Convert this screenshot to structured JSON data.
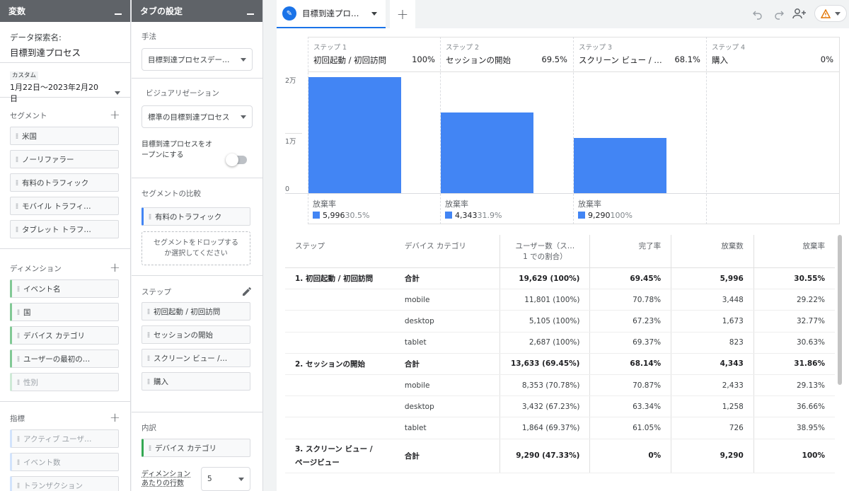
{
  "variables": {
    "header": "変数",
    "exploration_name_label": "データ探索名:",
    "exploration_name": "目標到達プロセス",
    "date_badge": "カスタム",
    "date_range": "1月22日～2023年2月20日",
    "segments_title": "セグメント",
    "segments": [
      "米国",
      "ノーリファラー",
      "有料のトラフィック",
      "モバイル トラフィ…",
      "タブレット トラフ…"
    ],
    "dimensions_title": "ディメンション",
    "dimensions": [
      "イベント名",
      "国",
      "デバイス カテゴリ",
      "ユーザーの最初の…",
      "性別"
    ],
    "metrics_title": "指標",
    "metrics": [
      "アクティブ ユーザ…",
      "イベント数",
      "トランザクション"
    ]
  },
  "tab_settings": {
    "header": "タブの設定",
    "technique_label": "手法",
    "technique_value": "目標到達プロセスデー…",
    "viz_label": "ビジュアリゼーション",
    "viz_value": "標準の目標到達プロセス",
    "open_funnel_label_1": "目標到達プロセスをオ",
    "open_funnel_label_2": "ープンにする",
    "segment_compare_title": "セグメントの比較",
    "segment_compare_chip": "有料のトラフィック",
    "drop_hint_1": "セグメントをドロップする",
    "drop_hint_2": "か選択してください",
    "steps_title": "ステップ",
    "steps": [
      "初回起動 / 初回訪問",
      "セッションの開始",
      "スクリーン ビュー /…",
      "購入"
    ],
    "breakdown_title": "内訳",
    "breakdown_chip": "デバイス カテゴリ",
    "rows_label_1": "ディメンション",
    "rows_label_2": "あたりの行数",
    "rows_value": "5"
  },
  "tabs": {
    "active_label": "目標到達プロ…",
    "add_label": "+"
  },
  "chart_data": {
    "type": "bar",
    "categories": [
      "初回起動 / 初回訪問",
      "セッションの開始",
      "スクリーン ビュー / …",
      "購入"
    ],
    "values": [
      19629,
      13633,
      9290,
      0
    ],
    "ylim": [
      0,
      20000
    ],
    "ytick_labels": [
      "2万",
      "1万",
      "0"
    ],
    "steps": [
      {
        "num": "ステップ 1",
        "name": "初回起動 / 初回訪問",
        "pct": "100%",
        "abandon_label": "放棄率",
        "abandon_value": "5,996",
        "abandon_pct": "30.5%"
      },
      {
        "num": "ステップ 2",
        "name": "セッションの開始",
        "pct": "69.5%",
        "abandon_label": "放棄率",
        "abandon_value": "4,343",
        "abandon_pct": "31.9%"
      },
      {
        "num": "ステップ 3",
        "name": "スクリーン ビュー / …",
        "pct": "68.1%",
        "abandon_label": "放棄率",
        "abandon_value": "9,290",
        "abandon_pct": "100%"
      },
      {
        "num": "ステップ 4",
        "name": "購入",
        "pct": "0%",
        "abandon_label": "",
        "abandon_value": "",
        "abandon_pct": ""
      }
    ],
    "bar_color": "#4285f4"
  },
  "table": {
    "headers": [
      "ステップ",
      "デバイス カテゴリ",
      "ユーザー数（ス…",
      "1 での割合）",
      "完了率",
      "放棄数",
      "放棄率"
    ],
    "rows": [
      {
        "step": "1. 初回起動 / 初回訪問",
        "step2": "",
        "device": "合計",
        "users": "19,629 (100%)",
        "completion": "69.45%",
        "abandons": "5,996",
        "abandon_rate": "30.55%",
        "total": true
      },
      {
        "step": "",
        "step2": "",
        "device": "mobile",
        "users": "11,801 (100%)",
        "completion": "70.78%",
        "abandons": "3,448",
        "abandon_rate": "29.22%",
        "total": false
      },
      {
        "step": "",
        "step2": "",
        "device": "desktop",
        "users": "5,105 (100%)",
        "completion": "67.23%",
        "abandons": "1,673",
        "abandon_rate": "32.77%",
        "total": false
      },
      {
        "step": "",
        "step2": "",
        "device": "tablet",
        "users": "2,687 (100%)",
        "completion": "69.37%",
        "abandons": "823",
        "abandon_rate": "30.63%",
        "total": false
      },
      {
        "step": "2. セッションの開始",
        "step2": "",
        "device": "合計",
        "users": "13,633 (69.45%)",
        "completion": "68.14%",
        "abandons": "4,343",
        "abandon_rate": "31.86%",
        "total": true
      },
      {
        "step": "",
        "step2": "",
        "device": "mobile",
        "users": "8,353 (70.78%)",
        "completion": "70.87%",
        "abandons": "2,433",
        "abandon_rate": "29.13%",
        "total": false
      },
      {
        "step": "",
        "step2": "",
        "device": "desktop",
        "users": "3,432 (67.23%)",
        "completion": "63.34%",
        "abandons": "1,258",
        "abandon_rate": "36.66%",
        "total": false
      },
      {
        "step": "",
        "step2": "",
        "device": "tablet",
        "users": "1,864 (69.37%)",
        "completion": "61.05%",
        "abandons": "726",
        "abandon_rate": "38.95%",
        "total": false
      },
      {
        "step": "3. スクリーン ビュー /",
        "step2": "ページビュー",
        "device": "合計",
        "users": "9,290 (47.33%)",
        "completion": "0%",
        "abandons": "9,290",
        "abandon_rate": "100%",
        "total": true
      }
    ]
  }
}
